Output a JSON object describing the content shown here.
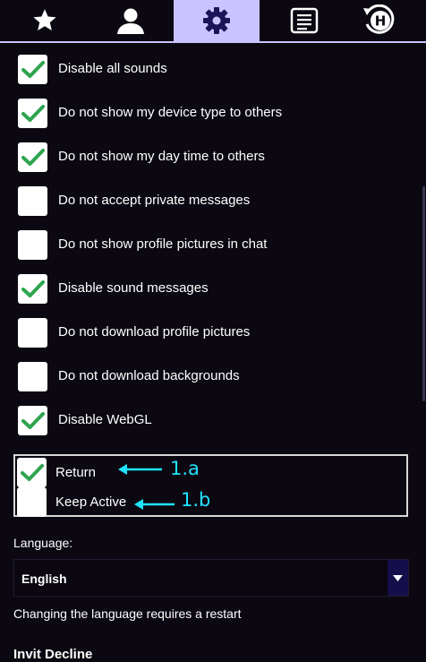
{
  "tabs": [
    {
      "icon": "star-icon",
      "active": false
    },
    {
      "icon": "user-icon",
      "active": false
    },
    {
      "icon": "gear-icon",
      "active": true
    },
    {
      "icon": "list-icon",
      "active": false
    },
    {
      "icon": "history-icon",
      "active": false
    }
  ],
  "options": [
    {
      "label": "Disable all sounds",
      "checked": true
    },
    {
      "label": "Do not show my device type to others",
      "checked": true
    },
    {
      "label": "Do not show my day time to others",
      "checked": true
    },
    {
      "label": "Do not accept private messages",
      "checked": false
    },
    {
      "label": "Do not show profile pictures in chat",
      "checked": false
    },
    {
      "label": "Disable sound messages",
      "checked": true
    },
    {
      "label": "Do not download profile pictures",
      "checked": false
    },
    {
      "label": "Do not download backgrounds",
      "checked": false
    },
    {
      "label": "Disable WebGL",
      "checked": true
    }
  ],
  "return_group": {
    "items": [
      {
        "label": "Return",
        "checked": true,
        "annotation": "1.a"
      },
      {
        "label": "Keep Active",
        "checked": false,
        "annotation": "1.b"
      }
    ]
  },
  "language": {
    "label": "Language:",
    "selected": "English",
    "note": "Changing the language requires a restart"
  },
  "next_section": {
    "title": "Invit Decline"
  },
  "colors": {
    "background": "#0b0811",
    "active_tab": "#c9c4ff",
    "tab_icon": "#1b1457",
    "check": "#2ea44f",
    "annotation": "#1fe3ff",
    "select_button": "#140e4a"
  }
}
